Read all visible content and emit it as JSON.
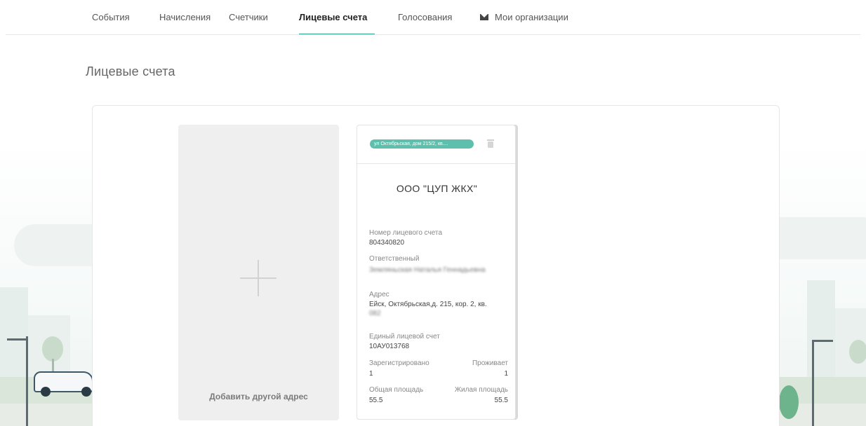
{
  "nav": {
    "items": [
      {
        "label": "События",
        "active": false
      },
      {
        "label": "Начисления",
        "active": false
      },
      {
        "label": "Счетчики",
        "active": false
      },
      {
        "label": "Лицевые счета",
        "active": true
      },
      {
        "label": "Голосования",
        "active": false
      },
      {
        "label": "Мои организации",
        "active": false,
        "icon": "envelope-icon"
      }
    ],
    "accent_color": "#2e9e88"
  },
  "page": {
    "title": "Лицевые счета"
  },
  "add_card": {
    "label": "Добавить другой адрес",
    "icon": "plus-icon"
  },
  "account_card": {
    "address_badge": "ул Октябрьская, дом 215/2, кв....",
    "badge_color": "#5ec0ac",
    "delete_icon": "trash-icon",
    "organization": "ООО \"ЦУП ЖКХ\"",
    "account_number_label": "Номер лицевого счета",
    "account_number": "804340820",
    "responsible_label": "Ответственный",
    "responsible": "Земляньская Наталья Геннадьевна",
    "address_label": "Адрес",
    "address_line1": "Ейск, Октябрьская,д. 215, кор. 2, кв.",
    "address_line2": "082",
    "single_account_label": "Единый лицевой счет",
    "single_account": "10АУ013768",
    "registered_label": "Зарегистрировано",
    "registered": "1",
    "residing_label": "Проживает",
    "residing": "1",
    "total_area_label": "Общая площадь",
    "total_area": "55.5",
    "living_area_label": "Жилая площадь",
    "living_area": "55.5"
  }
}
